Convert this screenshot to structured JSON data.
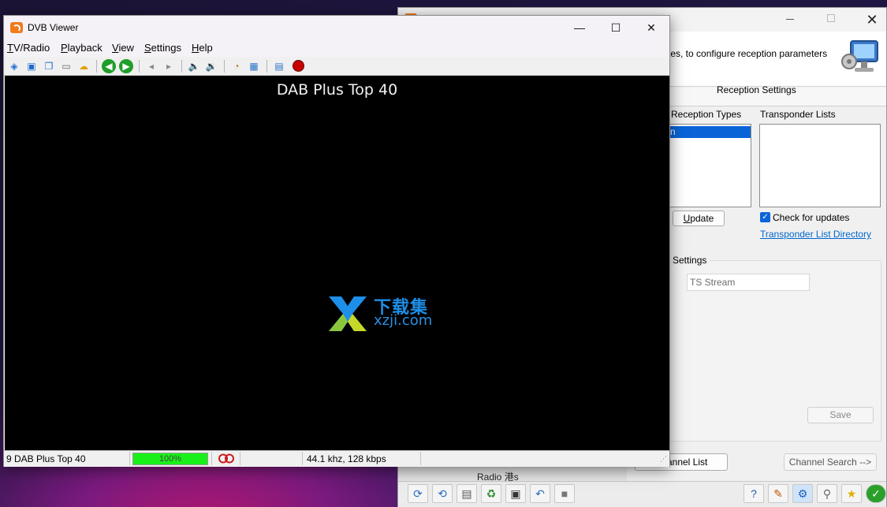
{
  "viewer": {
    "title": "DVB Viewer",
    "controls": {
      "minimize": "—",
      "maximize": "☐",
      "close": "✕"
    },
    "menu": [
      {
        "pre": "",
        "acc": "T",
        "post": "V/Radio"
      },
      {
        "pre": "",
        "acc": "P",
        "post": "layback"
      },
      {
        "pre": "",
        "acc": "V",
        "post": "iew"
      },
      {
        "pre": "",
        "acc": "S",
        "post": "ettings"
      },
      {
        "pre": "",
        "acc": "H",
        "post": "elp"
      }
    ],
    "osd_title": "DAB Plus Top 40",
    "status": {
      "channel": "9 DAB Plus Top 40",
      "signal_percent": 100,
      "signal_text": "100%",
      "audio_info": "44.1 khz, 128 kbps"
    }
  },
  "setup": {
    "banner_text": "tes, to configure reception parameters",
    "section_title": "Reception Settings",
    "reception_types_label": "Reception Types",
    "reception_selected": "n",
    "transponder_lists_label": "Transponder Lists",
    "update_button": "Update",
    "check_updates_label": "Check for updates",
    "check_updates_checked": true,
    "transponder_dir_link": "Transponder List Directory",
    "settings_group_label": "n Settings",
    "ts_stream_field": "TS Stream",
    "save_button": "Save",
    "channel_list_button": "Channel List",
    "channel_search_button": "Channel Search -->",
    "tree_item": "Radio 港s"
  },
  "watermark": {
    "cn": "下载集",
    "en": "xzji.com"
  },
  "colors": {
    "accent": "#0a64d8",
    "signal": "#19f019",
    "link": "#0066cc"
  }
}
